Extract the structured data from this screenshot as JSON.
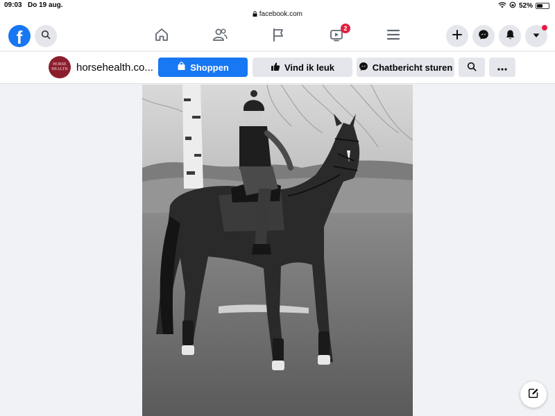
{
  "status_bar": {
    "time": "09:03",
    "date": "Do 19 aug.",
    "url": "facebook.com",
    "battery": "52%",
    "battery_level": 0.52
  },
  "navbar": {
    "logo_letter": "f",
    "watch_badge": "2",
    "icons": [
      "search-icon",
      "home-icon",
      "friends-icon",
      "pages-flag-icon",
      "watch-icon",
      "menu-icon",
      "plus-icon",
      "messenger-icon",
      "notifications-bell-icon",
      "account-caret-icon"
    ]
  },
  "page_header": {
    "avatar_text": "HORSE HEALTH",
    "name": "horsehealth.co...",
    "shop_label": "Shoppen",
    "like_label": "Vind ik leuk",
    "message_label": "Chatbericht sturen"
  },
  "colors": {
    "brand": "#1877f2",
    "badge": "#e41e3f",
    "page_avatar": "#8b1e2d"
  }
}
